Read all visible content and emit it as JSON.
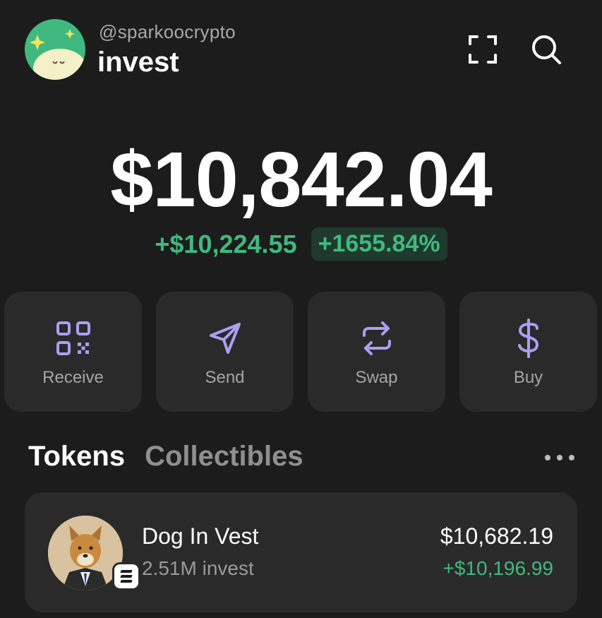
{
  "header": {
    "username": "@sparkoocrypto",
    "account_name": "invest",
    "icons": [
      "avatar",
      "scan-icon",
      "search-icon"
    ]
  },
  "balance": {
    "total": "$10,842.04",
    "change_amount": "+$10,224.55",
    "change_percent": "+1655.84%"
  },
  "actions": [
    {
      "label": "Receive",
      "icon": "qr-code-icon"
    },
    {
      "label": "Send",
      "icon": "send-icon"
    },
    {
      "label": "Swap",
      "icon": "swap-icon"
    },
    {
      "label": "Buy",
      "icon": "dollar-icon"
    }
  ],
  "tabs": [
    {
      "label": "Tokens",
      "active": true
    },
    {
      "label": "Collectibles",
      "active": false
    }
  ],
  "tokens": [
    {
      "name": "Dog In Vest",
      "amount": "2.51M invest",
      "value": "$10,682.19",
      "change": "+$10,196.99"
    }
  ],
  "colors": {
    "background": "#1c1c1c",
    "card": "#2a2a2a",
    "accent": "#ab9ff2",
    "positive": "#3fb97f",
    "avatar_bg": "#3fb97f"
  }
}
